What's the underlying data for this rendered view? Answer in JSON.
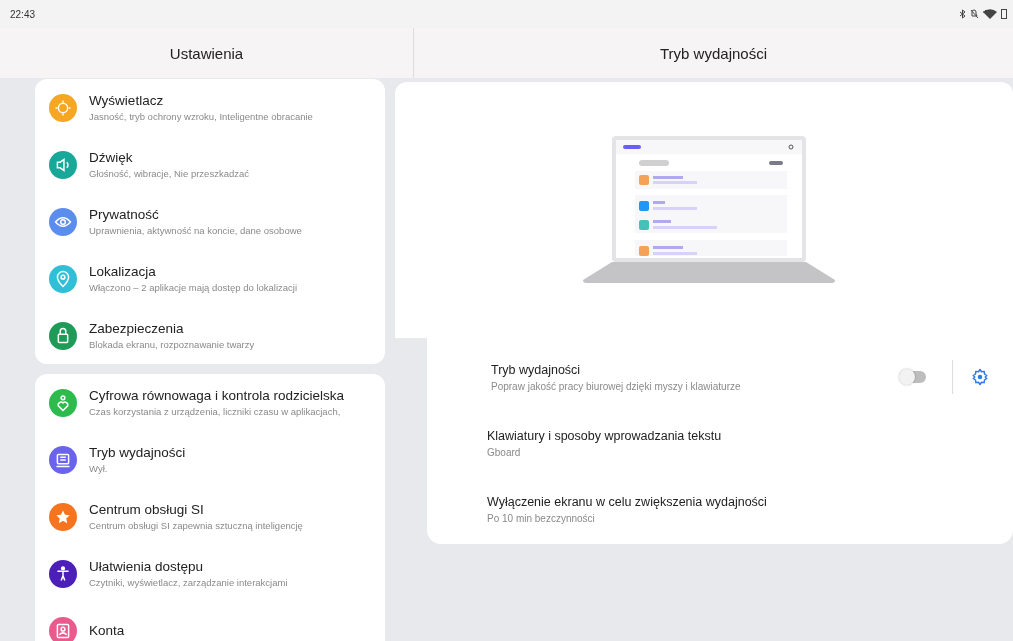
{
  "status_bar": {
    "time": "22:43"
  },
  "left_header": {
    "title": "Ustawienia"
  },
  "right_header": {
    "title": "Tryb wydajności"
  },
  "settings_groups": [
    {
      "items": [
        {
          "kind": "display",
          "color": "#f5a623",
          "title": "Wyświetlacz",
          "subtitle": "Jasność, tryb ochrony wzroku, Inteligentne obracanie"
        },
        {
          "kind": "sound",
          "color": "#17a89a",
          "title": "Dźwięk",
          "subtitle": "Głośność, wibracje, Nie przeszkadzać"
        },
        {
          "kind": "privacy",
          "color": "#5b8def",
          "title": "Prywatność",
          "subtitle": "Uprawnienia, aktywność na koncie, dane osobowe"
        },
        {
          "kind": "location",
          "color": "#2fc0d8",
          "title": "Lokalizacja",
          "subtitle": "Włączono – 2 aplikacje mają dostęp do lokalizacji"
        },
        {
          "kind": "security",
          "color": "#1e9b57",
          "title": "Zabezpieczenia",
          "subtitle": "Blokada ekranu, rozpoznawanie twarzy"
        }
      ]
    },
    {
      "items": [
        {
          "kind": "wellbeing",
          "color": "#2dbb4e",
          "title": "Cyfrowa równowaga i kontrola rodzicielska",
          "subtitle": "Czas korzystania z urządzenia, liczniki czasu w aplikacjach,"
        },
        {
          "kind": "productivity",
          "color": "#6a63ec",
          "title": "Tryb wydajności",
          "subtitle": "Wył."
        },
        {
          "kind": "ai",
          "color": "#f7741f",
          "title": "Centrum obsługi SI",
          "subtitle": "Centrum obsługi SI zapewnia sztuczną inteligencję"
        },
        {
          "kind": "accessibility",
          "color": "#4b1fb8",
          "title": "Ułatwienia dostępu",
          "subtitle": "Czytniki, wyświetlacz, zarządzanie interakcjami"
        },
        {
          "kind": "accounts",
          "color": "#ea5a8c",
          "title": "Konta"
        }
      ]
    }
  ],
  "detail_rows": [
    {
      "kind": "toggle",
      "title": "Tryb wydajności",
      "subtitle": "Popraw jakość pracy biurowej dzięki myszy i klawiaturze",
      "on": false
    },
    {
      "kind": "link",
      "title": "Klawiatury i sposoby wprowadzania tekstu",
      "subtitle": "Gboard"
    },
    {
      "kind": "link",
      "title": "Wyłączenie ekranu w celu zwiększenia wydajności",
      "subtitle": "Po 10 min bezczynności"
    }
  ]
}
